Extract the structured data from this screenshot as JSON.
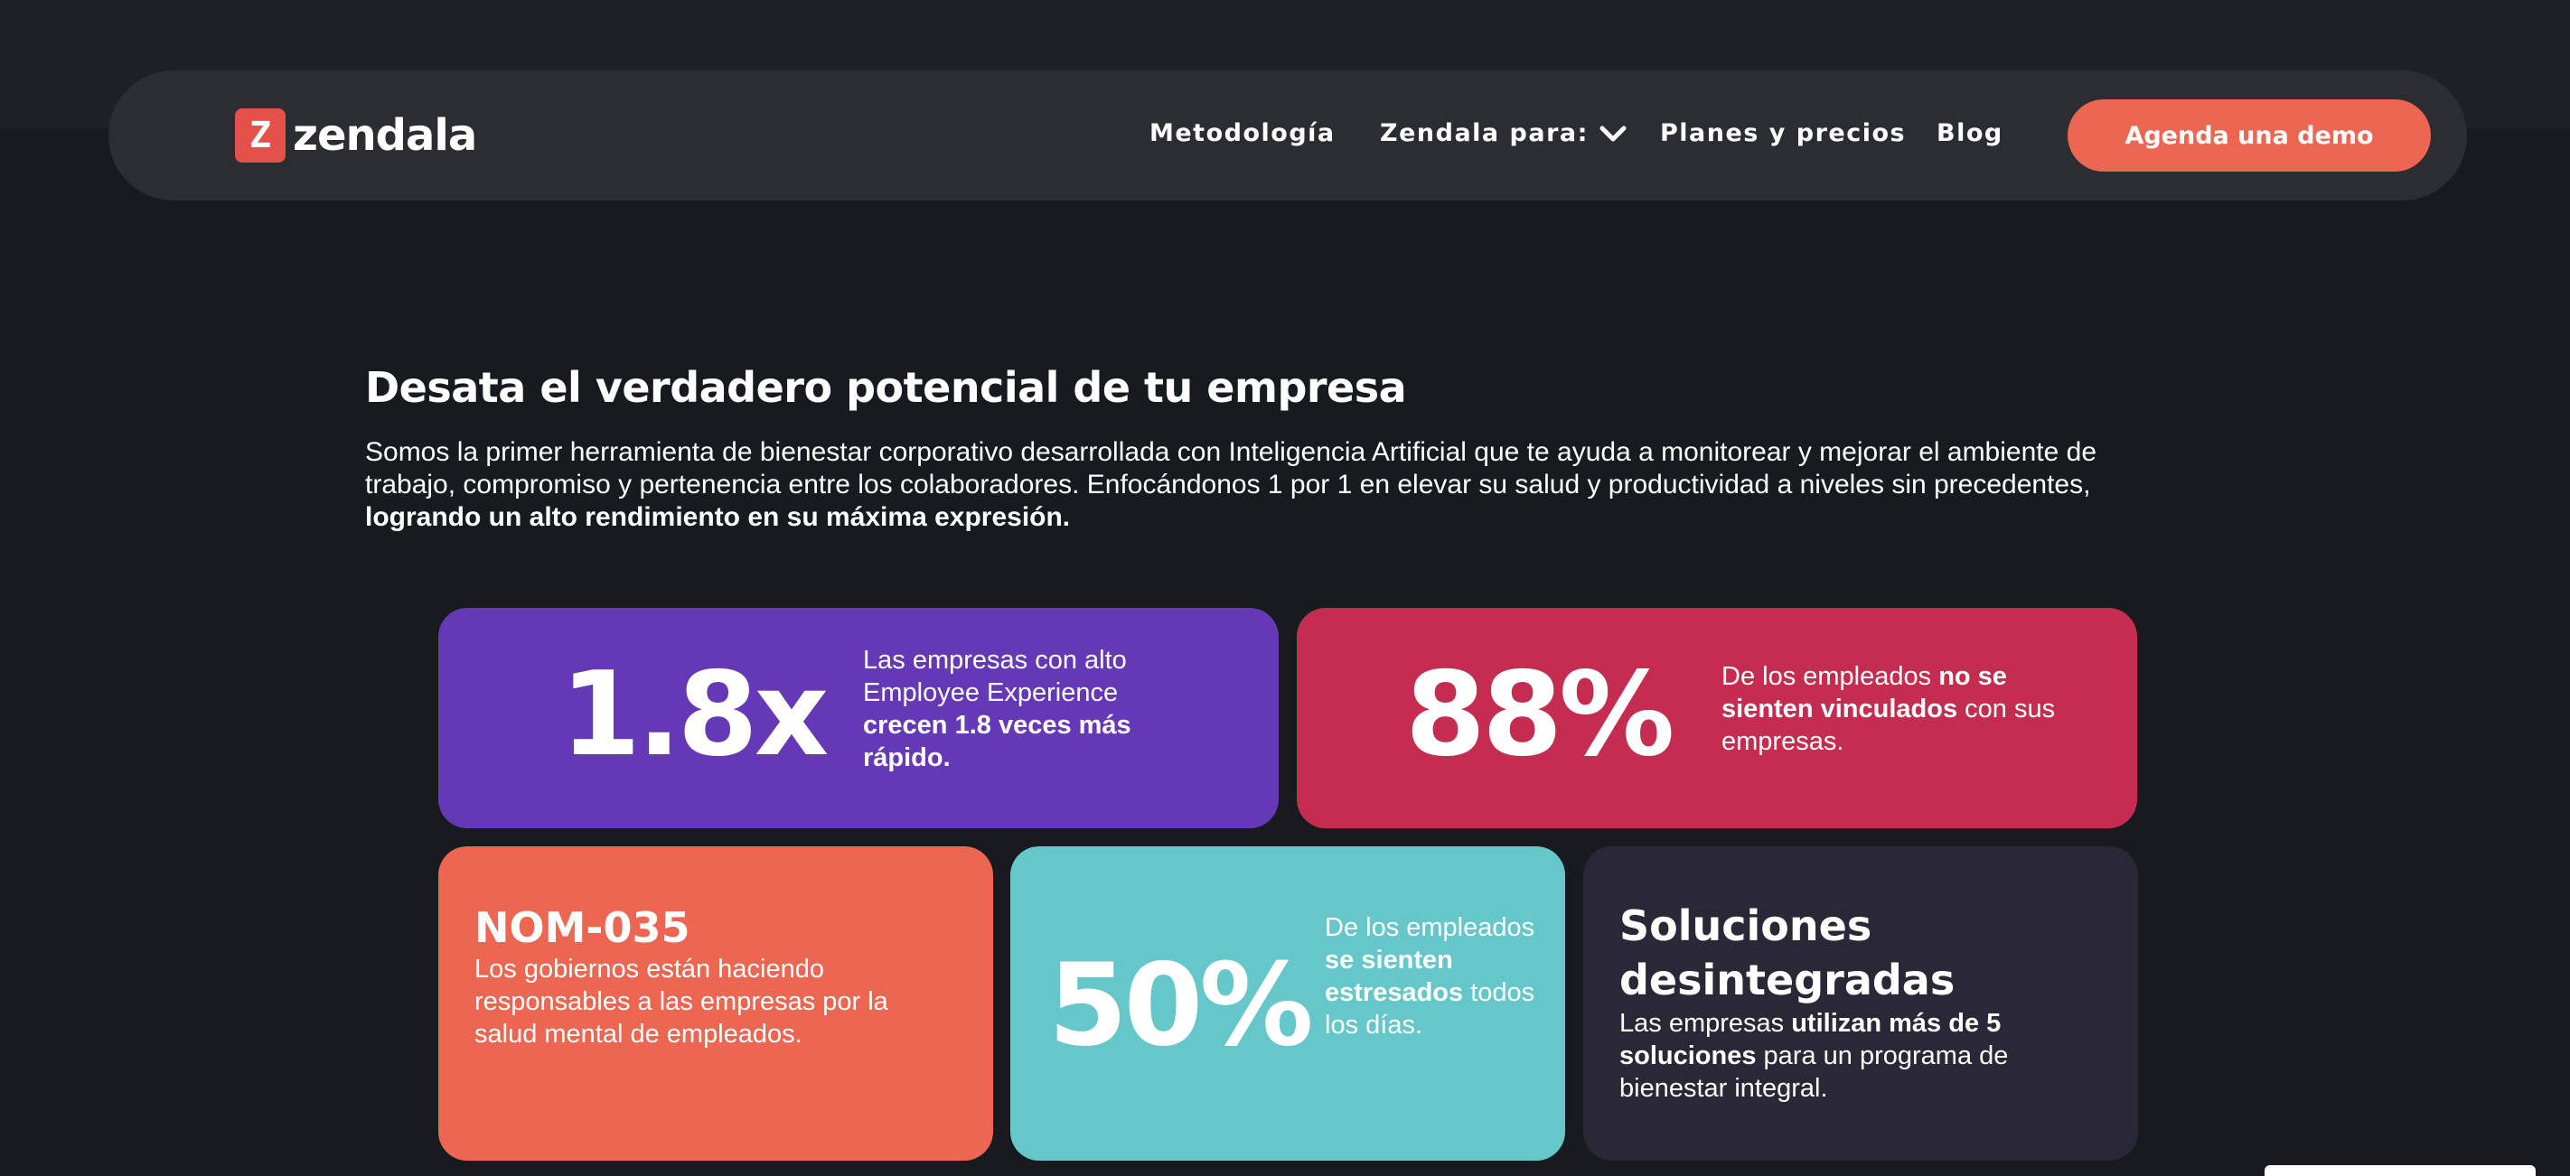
{
  "header": {
    "logo_mark": "Z",
    "logo_text": "zendala",
    "nav": [
      {
        "label": "Metodología"
      },
      {
        "label": "Zendala para:"
      },
      {
        "label": "Planes y precios"
      },
      {
        "label": "Blog"
      }
    ],
    "cta_label": "Agenda una demo"
  },
  "hero": {
    "title": "Desata el verdadero potencial de tu empresa",
    "intro": "Somos la primer herramienta de bienestar corporativo desarrollada con Inteligencia Artificial que te ayuda a monitorear y mejorar el ambiente de trabajo, compromiso y pertenencia entre los colaboradores. Enfocándonos 1 por 1 en elevar su salud y productividad a niveles sin precedentes, ",
    "intro_bold": "logrando un alto rendimiento en su máxima expresión."
  },
  "stats": {
    "card1": {
      "value": "1.8x",
      "text": "Las empresas con alto Employee Experience ",
      "bold": "crecen 1.8 veces más rápido."
    },
    "card2": {
      "value": "88%",
      "text_before": "De los empleados ",
      "bold": "no se sienten vinculados",
      "text_after": " con sus empresas."
    },
    "card3": {
      "title": "NOM-035",
      "text": "Los gobiernos están haciendo responsables a las empresas por la salud mental de empleados."
    },
    "card4": {
      "value": "50%",
      "text_before": "De los empleados ",
      "bold": "se sienten estresados",
      "text_after": " todos los días."
    },
    "card5": {
      "title": "Soluciones desintegradas",
      "text_before": "Las empresas ",
      "bold": "utilizan más de 5 soluciones",
      "text_after": " para un programa de bienestar integral."
    }
  },
  "colors": {
    "background": "#171b1f",
    "navbar": "#2b2d33",
    "accent": "#ec6651",
    "purple": "#6538b5",
    "crimson": "#c42d50",
    "teal": "#65c7ca",
    "dark_card": "#2a2836"
  },
  "icons": {
    "dropdown": "chevron-down-icon"
  }
}
